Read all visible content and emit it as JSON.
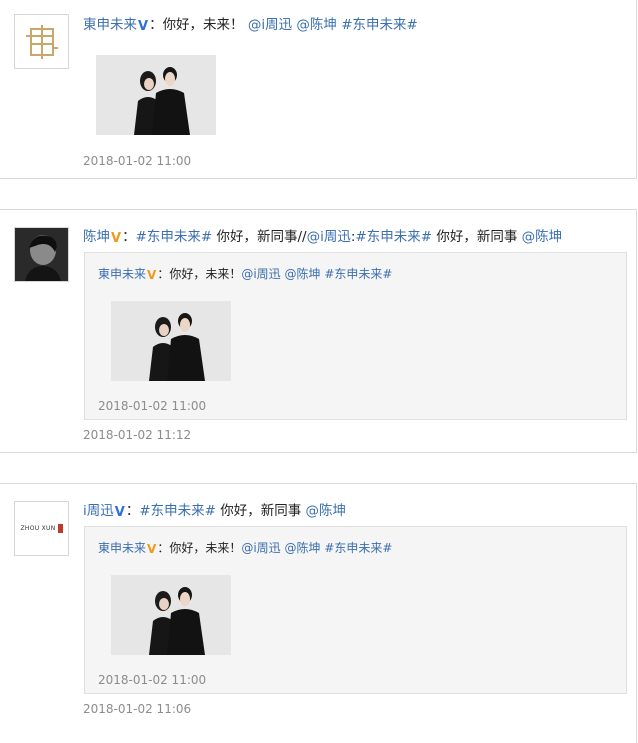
{
  "posts": [
    {
      "user": "東申未来",
      "verified_color": "#2f6fd6",
      "avatar_icon": "dongshen-logo",
      "colon": "：",
      "text_a": "你好，未来！",
      "mention_1": "@i周迅",
      "mention_2": "@陈坤",
      "hashtag": "#东申未来#",
      "timestamp": "2018-01-02 11:00"
    },
    {
      "user": "陈坤",
      "verified_color": "#f09a1a",
      "avatar_icon": "chen-kun-avatar",
      "colon": "：",
      "hashtag": "#东申未来#",
      "text_a": "你好，新同事//",
      "repost_user": "@i周迅",
      "repost_colon": ":",
      "repost_hashtag": "#东申未来#",
      "text_b": "你好，新同事",
      "mention": "@陈坤",
      "timestamp": "2018-01-02 11:12",
      "quoted": {
        "user": "東申未来",
        "colon": "：",
        "text": "你好，未来！",
        "mention_1": "@i周迅",
        "mention_2": "@陈坤",
        "hashtag": "#东申未来#",
        "timestamp": "2018-01-02 11:00"
      }
    },
    {
      "user": "i周迅",
      "verified_color": "#2f6fd6",
      "avatar_icon": "zhou-xun-logo",
      "avatar_text": "ZHOU XUN",
      "colon": "：",
      "hashtag": "#东申未来#",
      "text_a": "你好，新同事",
      "mention": "@陈坤",
      "timestamp": "2018-01-02 11:06",
      "quoted": {
        "user": "東申未来",
        "colon": "：",
        "text": "你好，未来！",
        "mention_1": "@i周迅",
        "mention_2": "@陈坤",
        "hashtag": "#东申未来#",
        "timestamp": "2018-01-02 11:00"
      }
    }
  ],
  "badge_letter": "V"
}
